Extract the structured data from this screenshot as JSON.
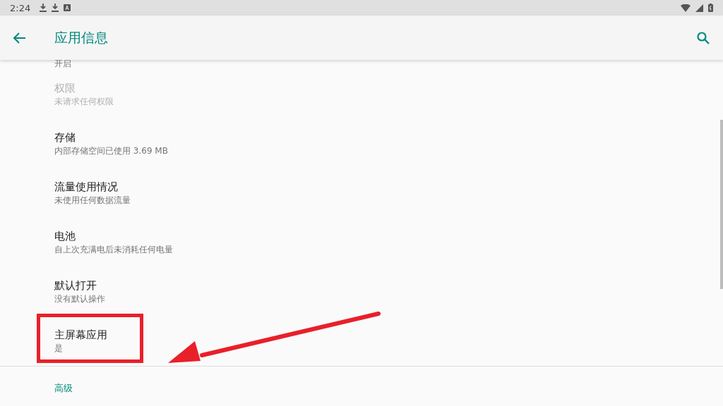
{
  "status_bar": {
    "time": "2:24"
  },
  "app_bar": {
    "title": "应用信息"
  },
  "top_partial": {
    "summary": "开启"
  },
  "items": [
    {
      "title": "权限",
      "summary": "未请求任何权限",
      "disabled": true,
      "highlighted": false
    },
    {
      "title": "存储",
      "summary": "内部存储空间已使用 3.69 MB",
      "disabled": false,
      "highlighted": false
    },
    {
      "title": "流量使用情况",
      "summary": "未使用任何数据流量",
      "disabled": false,
      "highlighted": false
    },
    {
      "title": "电池",
      "summary": "自上次充满电后未消耗任何电量",
      "disabled": false,
      "highlighted": false
    },
    {
      "title": "默认打开",
      "summary": "没有默认操作",
      "disabled": false,
      "highlighted": false
    },
    {
      "title": "主屏幕应用",
      "summary": "是",
      "disabled": false,
      "highlighted": true
    }
  ],
  "section": {
    "title": "高级"
  }
}
